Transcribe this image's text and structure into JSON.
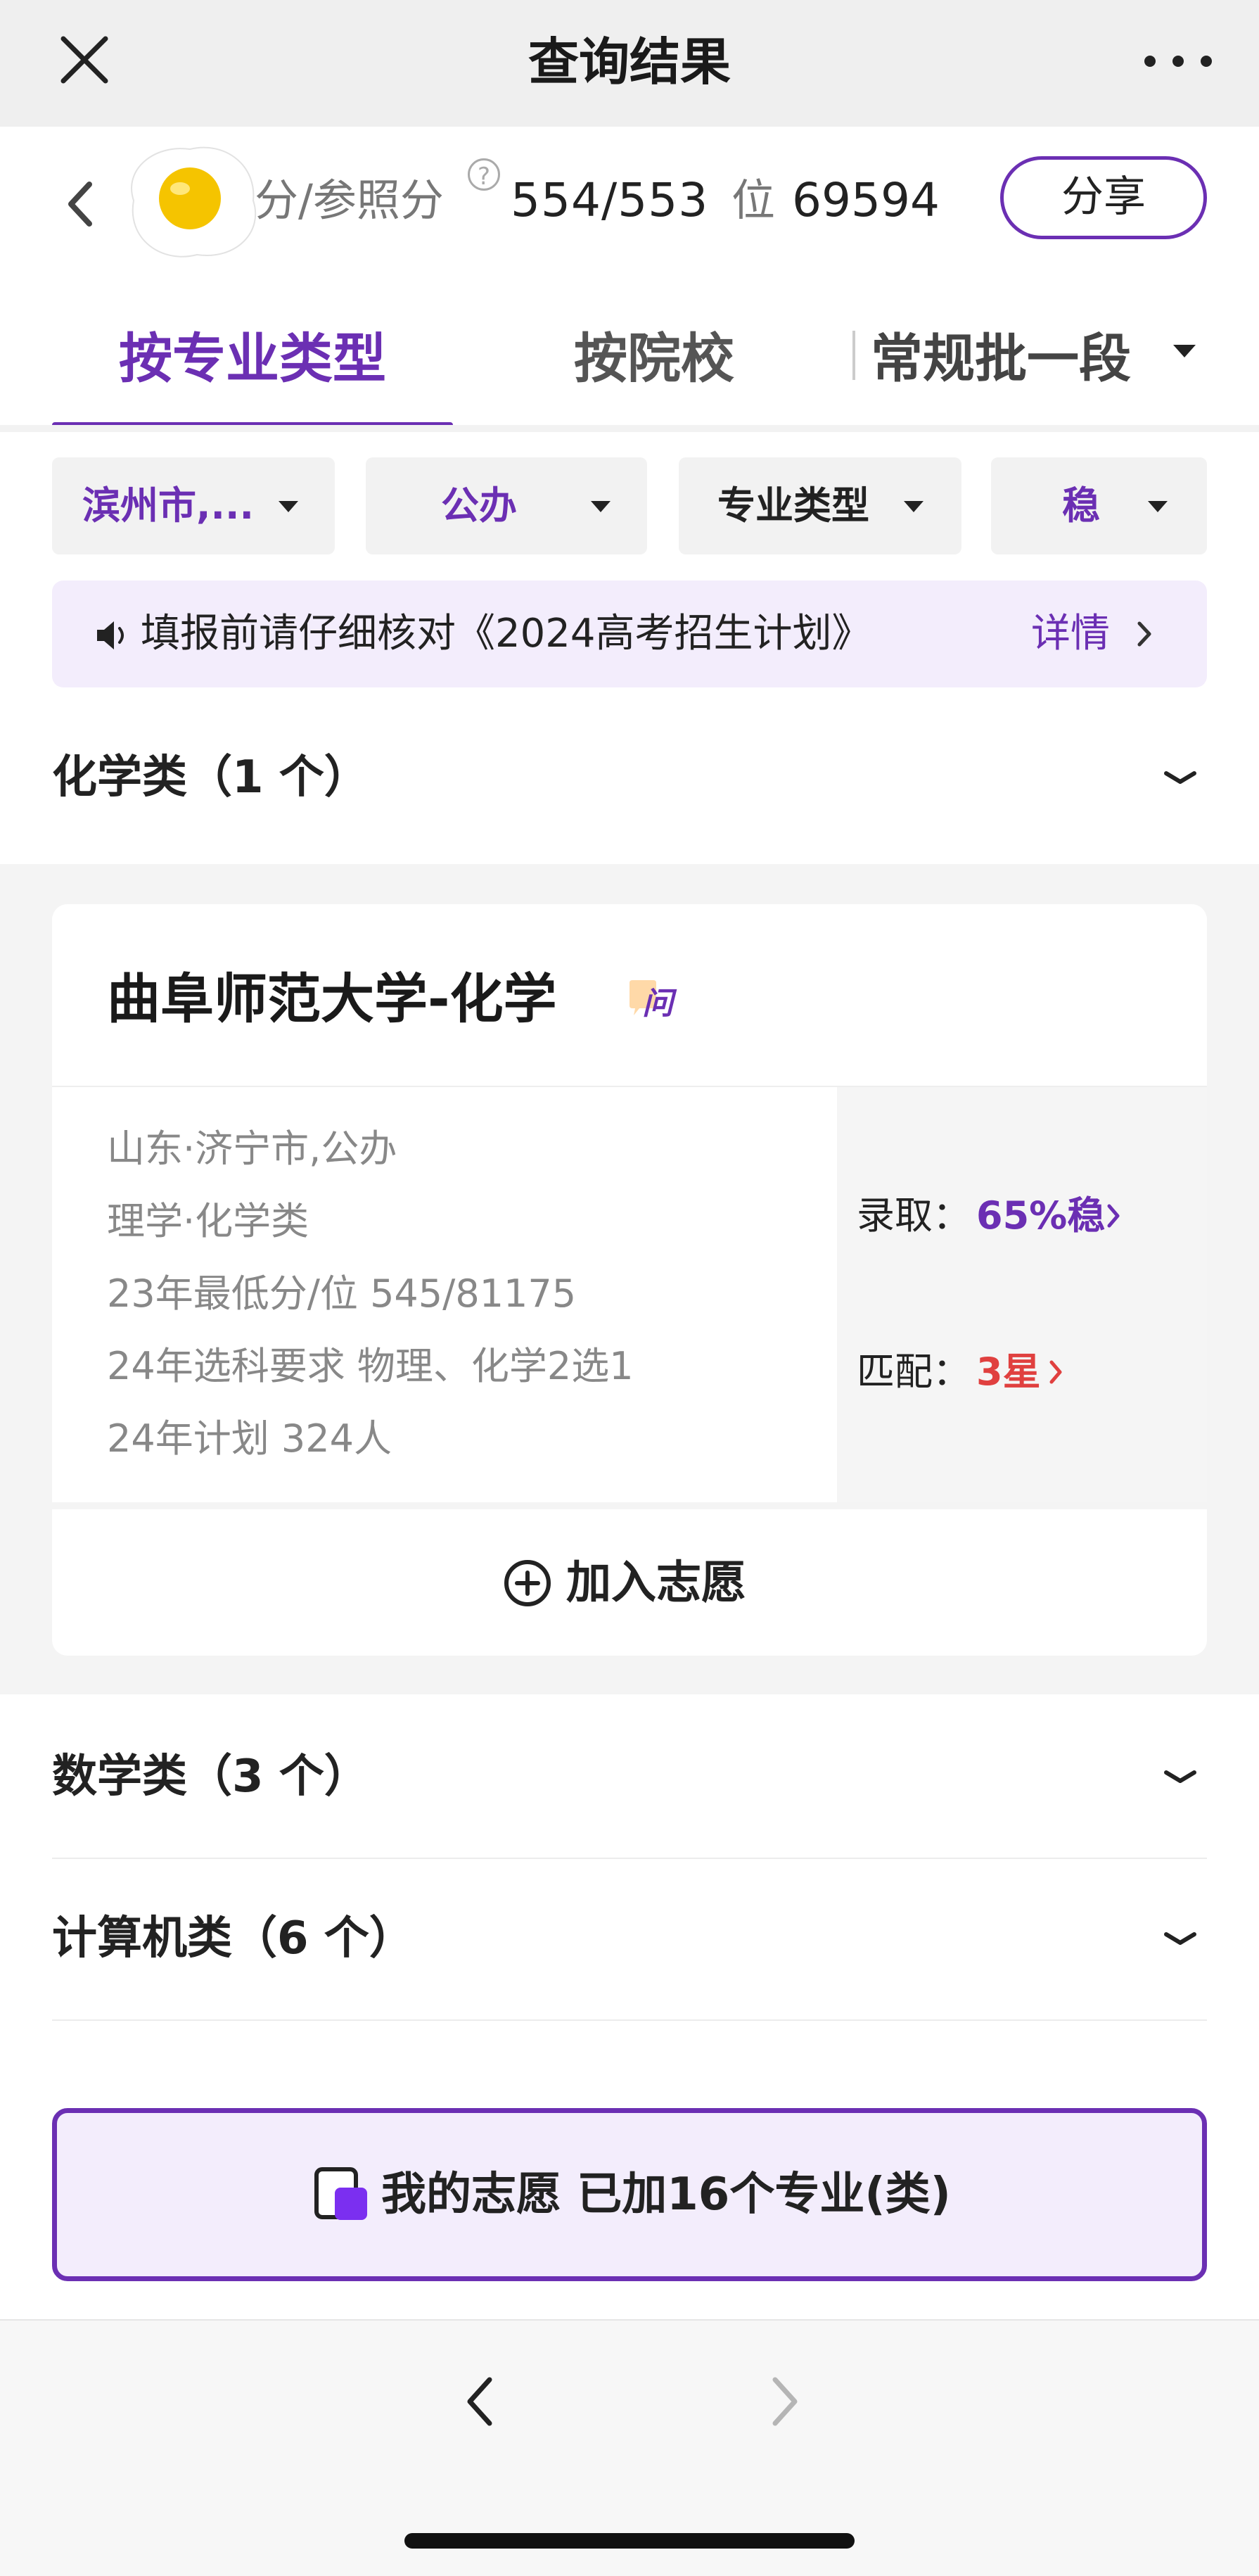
{
  "navbar": {
    "title": "查询结果",
    "close_icon": "close-icon",
    "more_icon": "more-horizontal-icon"
  },
  "score": {
    "label": "分/参照分",
    "help_mark": "?",
    "value": "554/553",
    "rank_label": "位",
    "rank_value": "69594",
    "share_label": "分享"
  },
  "tabs": [
    {
      "label": "按专业类型",
      "active": true
    },
    {
      "label": "按院校",
      "active": false
    }
  ],
  "batch": {
    "label": "常规批一段"
  },
  "filters": [
    {
      "label": "滨州市,...",
      "color": "#6b2fb3"
    },
    {
      "label": "公办",
      "color": "#6b2fb3"
    },
    {
      "label": "专业类型",
      "color": "#222222"
    },
    {
      "label": "稳",
      "color": "#6b2fb3"
    }
  ],
  "notice": {
    "text": "填报前请仔细核对《2024高考招生计划》",
    "detail_label": "详情"
  },
  "categories": {
    "chemistry": "化学类（1 个）",
    "math": "数学类（3 个）",
    "computer": "计算机类（6 个）"
  },
  "card": {
    "title": "曲阜师范大学-化学",
    "ask_badge": "问",
    "info": [
      "山东·济宁市,公办",
      "理学·化学类",
      "23年最低分/位 545/81175",
      "24年选科要求 物理、化学2选1",
      "24年计划 324人"
    ],
    "admission_label": "录取：",
    "admission_value": "65%稳",
    "match_label": "匹配：",
    "match_value": "3星",
    "add_button": "加入志愿"
  },
  "wishlist": {
    "label": "我的志愿  已加16个专业(类)"
  },
  "colors": {
    "accent": "#6b2fb3",
    "accent_light": "#f3edfc",
    "danger": "#e0403f"
  }
}
